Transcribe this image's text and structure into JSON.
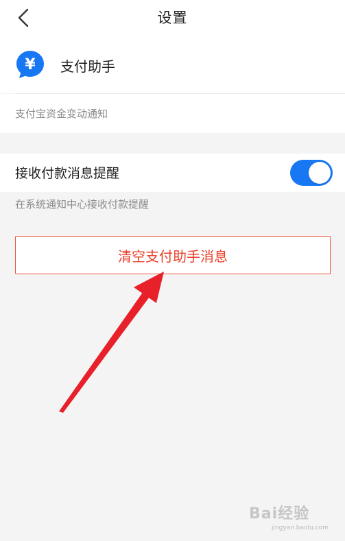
{
  "header": {
    "title": "设置"
  },
  "profile": {
    "name": "支付助手",
    "avatar_symbol": "¥",
    "avatar_color": "#1877f2",
    "description": "支付宝资金变动通知"
  },
  "setting": {
    "label": "接收付款消息提醒",
    "enabled": true,
    "hint": "在系统通知中心接收付款提醒",
    "toggle_color": "#1877f2"
  },
  "actions": {
    "clear_label": "清空支付助手消息",
    "clear_color": "#e8402a"
  },
  "annotation": {
    "arrow_color": "#e8202a"
  },
  "watermark": {
    "brand": "Bai经验",
    "url": "jingyan.baidu.com"
  }
}
